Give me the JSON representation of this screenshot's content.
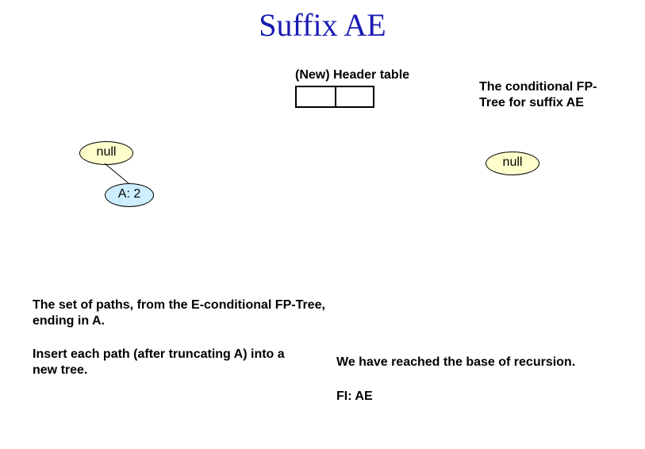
{
  "title": "Suffix AE",
  "header_table_label": "(New) Header table",
  "conditional_fp_label": "The conditional FP-Tree for suffix AE",
  "left_tree": {
    "root": "null",
    "child": "A: 2"
  },
  "right_tree": {
    "root": "null"
  },
  "paths_text": "The set of paths, from the E-conditional FP-Tree, ending in A.",
  "insert_text": "Insert each path (after truncating A) into a new tree.",
  "base_recursion_text": "We have reached the base of recursion.",
  "fi_text": "FI: AE",
  "chart_data": {
    "type": "diagram",
    "description": "FP-Tree conditional pattern base for suffix AE",
    "left_tree_edges": [
      {
        "from": "null",
        "to": "A:2"
      }
    ],
    "right_tree_edges": [],
    "header_table": {
      "columns": 2,
      "rows": 1,
      "cells": [
        "",
        ""
      ]
    }
  }
}
